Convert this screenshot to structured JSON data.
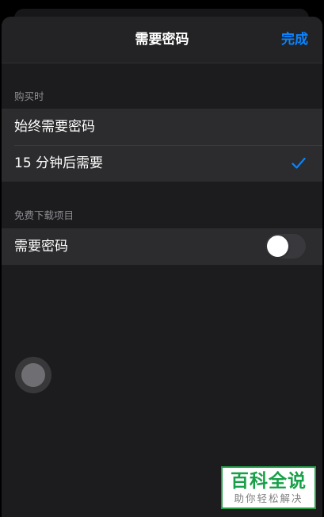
{
  "navbar": {
    "title": "需要密码",
    "done_label": "完成"
  },
  "sections": [
    {
      "header": "购买时",
      "rows": [
        {
          "label": "始终需要密码",
          "selected": false
        },
        {
          "label": "15 分钟后需要",
          "selected": true
        }
      ]
    },
    {
      "header": "免费下载项目",
      "rows": [
        {
          "label": "需要密码",
          "toggle_on": false
        }
      ]
    }
  ],
  "colors": {
    "accent": "#0a84ff",
    "sheet_background": "#1c1c1e",
    "row_background": "#2c2c2e",
    "watermark_green": "#18a048"
  },
  "icons": {
    "selected_row": "checkmark-icon",
    "assistive_touch": "assistive-touch-icon"
  },
  "watermark": {
    "title": "百科全说",
    "subtitle": "助你轻松解决"
  }
}
